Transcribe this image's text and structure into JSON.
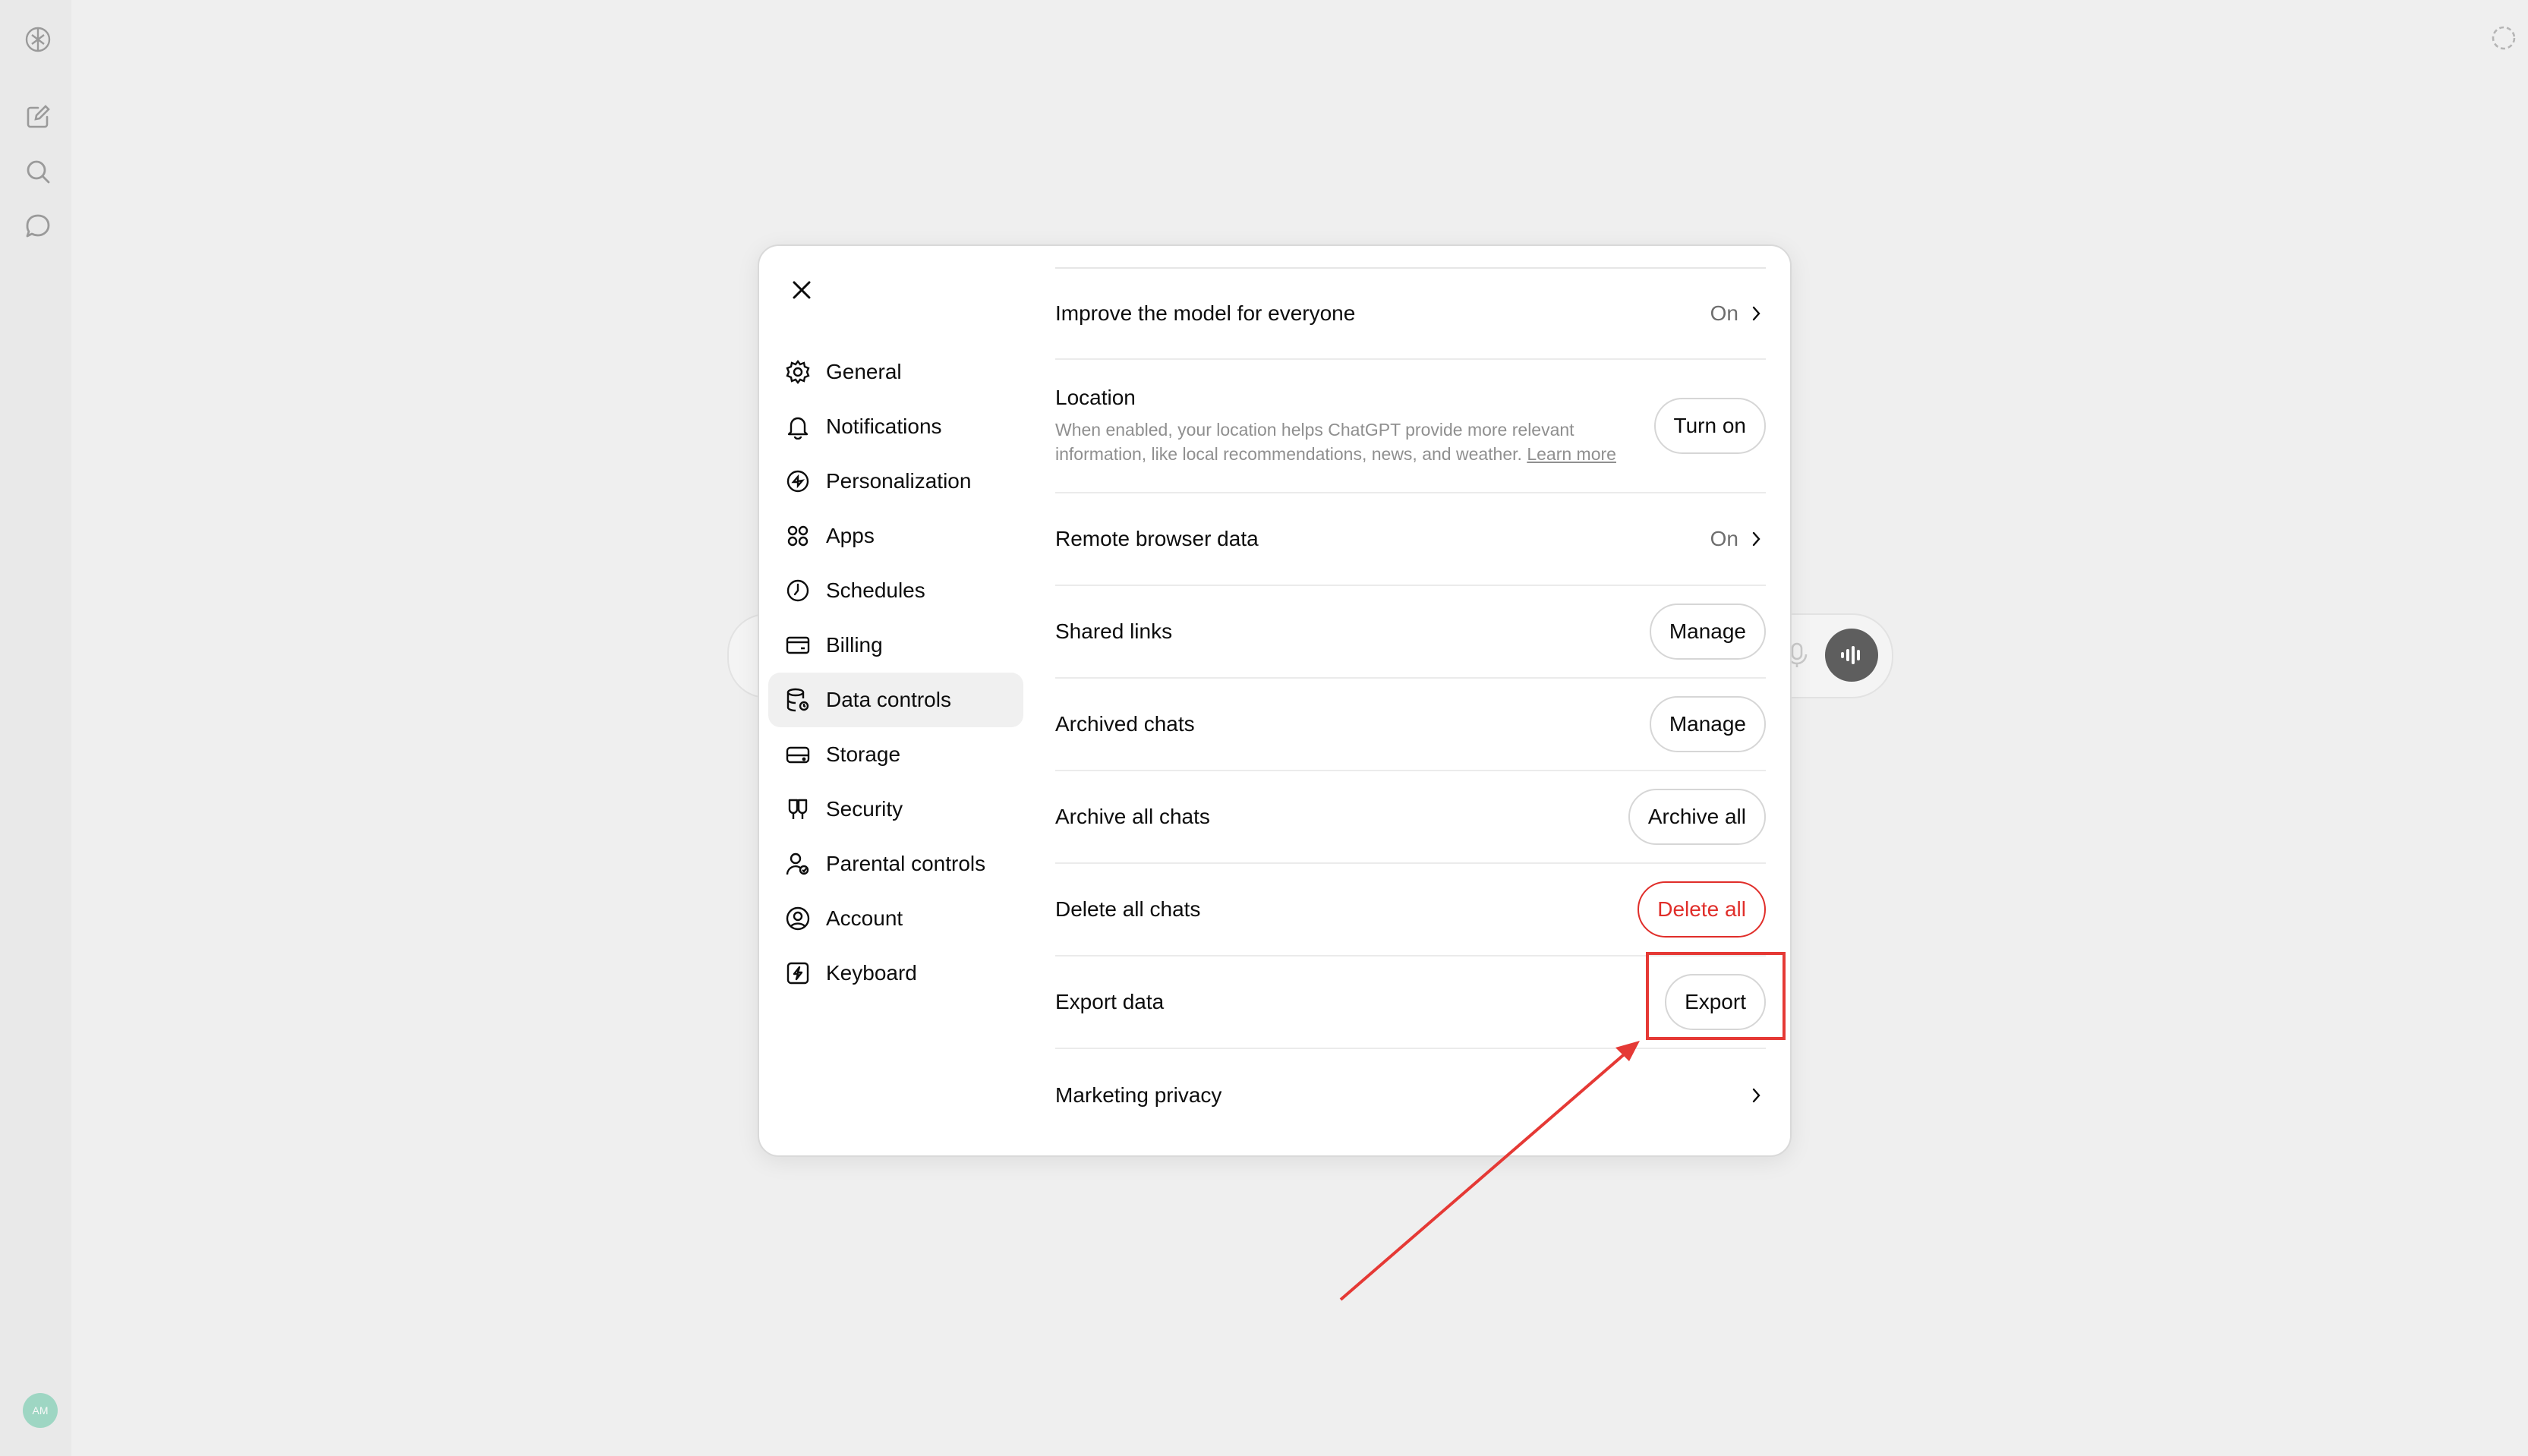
{
  "sidebar_rail": {
    "icons": [
      "openai-logo-icon",
      "new-chat-icon",
      "search-icon",
      "chat-bubble-icon"
    ],
    "avatar_initials": "AM"
  },
  "modal": {
    "nav": [
      {
        "label": "General",
        "icon": "gear-icon"
      },
      {
        "label": "Notifications",
        "icon": "bell-icon"
      },
      {
        "label": "Personalization",
        "icon": "personalization-icon"
      },
      {
        "label": "Apps",
        "icon": "apps-grid-icon"
      },
      {
        "label": "Schedules",
        "icon": "clock-icon"
      },
      {
        "label": "Billing",
        "icon": "card-icon"
      },
      {
        "label": "Data controls",
        "icon": "database-icon",
        "active": true
      },
      {
        "label": "Storage",
        "icon": "storage-icon"
      },
      {
        "label": "Security",
        "icon": "security-icon"
      },
      {
        "label": "Parental controls",
        "icon": "parent-icon"
      },
      {
        "label": "Account",
        "icon": "account-icon"
      },
      {
        "label": "Keyboard",
        "icon": "keyboard-icon"
      }
    ],
    "settings": {
      "improve": {
        "label": "Improve the model for everyone",
        "value": "On"
      },
      "location": {
        "title": "Location",
        "description": "When enabled, your location helps ChatGPT provide more relevant information, like local recommendations, news, and weather.",
        "learn_more": "Learn more",
        "button": "Turn on"
      },
      "remote_browser": {
        "label": "Remote browser data",
        "value": "On"
      },
      "shared_links": {
        "label": "Shared links",
        "button": "Manage"
      },
      "archived_chats": {
        "label": "Archived chats",
        "button": "Manage"
      },
      "archive_all": {
        "label": "Archive all chats",
        "button": "Archive all"
      },
      "delete_all": {
        "label": "Delete all chats",
        "button": "Delete all"
      },
      "export": {
        "label": "Export data",
        "button": "Export"
      },
      "marketing": {
        "label": "Marketing privacy"
      }
    }
  },
  "colors": {
    "danger": "#e02e2a",
    "annotation": "#e53935"
  }
}
